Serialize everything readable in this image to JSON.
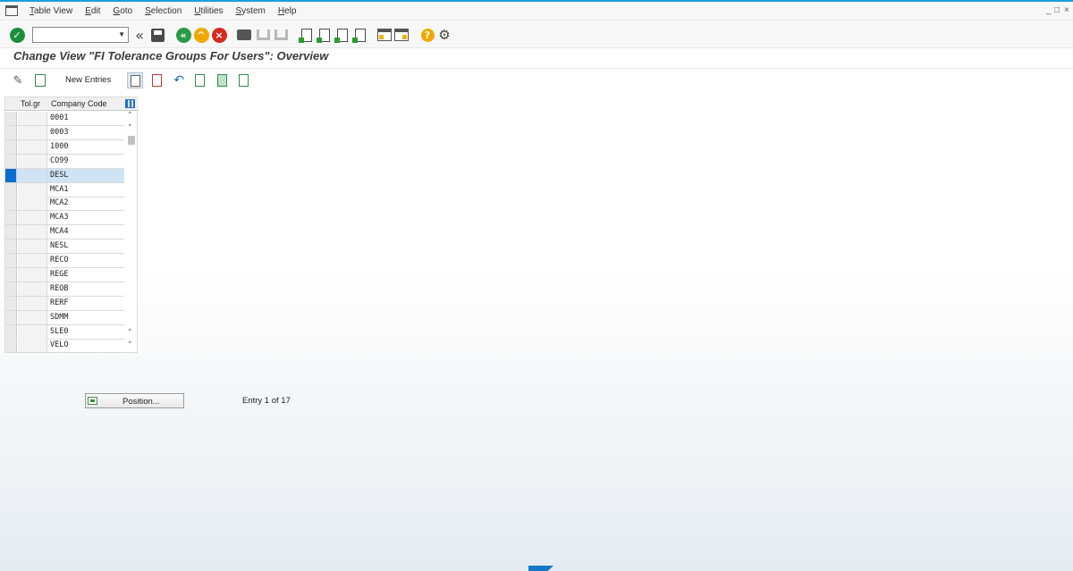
{
  "menu": {
    "items": [
      "Table View",
      "Edit",
      "Goto",
      "Selection",
      "Utilities",
      "System",
      "Help"
    ]
  },
  "window_controls": {
    "minimize": "_",
    "restore": "□",
    "close": "×"
  },
  "command_field": {
    "value": ""
  },
  "title": "Change View \"FI Tolerance Groups For Users\": Overview",
  "app_toolbar": {
    "new_entries": "New Entries"
  },
  "table": {
    "columns": [
      "Tol.gr",
      "Company Code"
    ],
    "rows": [
      {
        "tol_gr": "",
        "company_code": "0001"
      },
      {
        "tol_gr": "",
        "company_code": "0003"
      },
      {
        "tol_gr": "",
        "company_code": "1000"
      },
      {
        "tol_gr": "",
        "company_code": "CO99"
      },
      {
        "tol_gr": "",
        "company_code": "DESL"
      },
      {
        "tol_gr": "",
        "company_code": "MCA1"
      },
      {
        "tol_gr": "",
        "company_code": "MCA2"
      },
      {
        "tol_gr": "",
        "company_code": "MCA3"
      },
      {
        "tol_gr": "",
        "company_code": "MCA4"
      },
      {
        "tol_gr": "",
        "company_code": "NESL"
      },
      {
        "tol_gr": "",
        "company_code": "RECO"
      },
      {
        "tol_gr": "",
        "company_code": "REGE"
      },
      {
        "tol_gr": "",
        "company_code": "REOB"
      },
      {
        "tol_gr": "",
        "company_code": "RERF"
      },
      {
        "tol_gr": "",
        "company_code": "SDMM"
      },
      {
        "tol_gr": "",
        "company_code": "SLE0"
      },
      {
        "tol_gr": "",
        "company_code": "VELO"
      }
    ],
    "selected_row": 4
  },
  "position_button": {
    "label": "Position..."
  },
  "entry_info": "Entry 1 of 17",
  "colors": {
    "accent": "#1a9fe0",
    "selection": "#0a6ed1",
    "ok_green": "#1e8e3e",
    "cancel_red": "#d52b1e",
    "back_green": "#2b9a46",
    "exit_yellow": "#f0a800"
  }
}
